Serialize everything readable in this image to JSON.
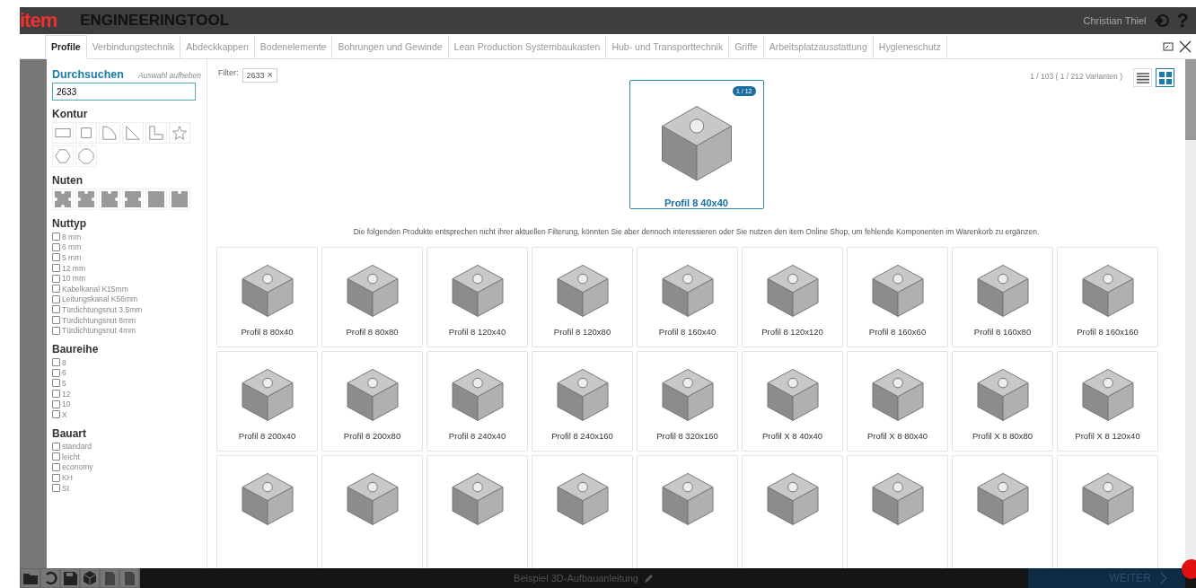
{
  "header": {
    "logo": "item",
    "title": "ENGINEERINGTOOL",
    "user": "Christian Thiel",
    "help": "?"
  },
  "tabs": [
    {
      "label": "Profile",
      "selected": true
    },
    {
      "label": "Verbindungstechnik",
      "selected": false
    },
    {
      "label": "Abdeckkappen",
      "selected": false
    },
    {
      "label": "Bodenelemente",
      "selected": false
    },
    {
      "label": "Bohrungen und Gewinde",
      "selected": false
    },
    {
      "label": "Lean Production Systembaukasten",
      "selected": false
    },
    {
      "label": "Hub- und Transporttechnik",
      "selected": false
    },
    {
      "label": "Griffe",
      "selected": false
    },
    {
      "label": "Arbeitsplatzausstattung",
      "selected": false
    },
    {
      "label": "Hygieneschutz",
      "selected": false
    }
  ],
  "sidebar": {
    "search_title": "Durchsuchen",
    "clear_link": "Auswahl aufheben",
    "search_value": "2633",
    "kontur_title": "Kontur",
    "nuten_title": "Nuten",
    "groups": [
      {
        "title": "Nuttyp",
        "options": [
          {
            "label": "8 mm",
            "checked": false
          },
          {
            "label": "6 mm",
            "checked": false
          },
          {
            "label": "5 mm",
            "checked": false
          },
          {
            "label": "12 mm",
            "checked": false
          },
          {
            "label": "10 mm",
            "checked": false
          },
          {
            "label": "Kabelkanal K15mm",
            "checked": false
          },
          {
            "label": "Leitungskanal K56mm",
            "checked": false
          },
          {
            "label": "Türdichtungsnut 3.5mm",
            "checked": false
          },
          {
            "label": "Türdichtungsnut 8mm",
            "checked": false
          },
          {
            "label": "Türdichtungsnut 4mm",
            "checked": false
          }
        ]
      },
      {
        "title": "Baureihe",
        "options": [
          {
            "label": "8",
            "checked": false
          },
          {
            "label": "6",
            "checked": false
          },
          {
            "label": "5",
            "checked": false
          },
          {
            "label": "12",
            "checked": false
          },
          {
            "label": "10",
            "checked": false
          },
          {
            "label": "X",
            "checked": false
          }
        ]
      },
      {
        "title": "Bauart",
        "options": [
          {
            "label": "standard",
            "checked": false
          },
          {
            "label": "leicht",
            "checked": false
          },
          {
            "label": "economy",
            "checked": false
          },
          {
            "label": "KH",
            "checked": false
          },
          {
            "label": "St",
            "checked": false
          }
        ]
      }
    ]
  },
  "main": {
    "filter_label": "Filter:",
    "filter_chip": "2633",
    "filter_remove": "×",
    "count": "1 / 103 ( 1 / 212 Varianten )",
    "views": [
      {
        "kind": "list",
        "selected": false
      },
      {
        "kind": "grid",
        "selected": true
      }
    ],
    "featured": {
      "name": "Profil 8 40x40",
      "badge": "1 / 12"
    },
    "notice": "Die folgenden Produkte entsprechen nicht ihrer aktuellen Filterung, könnten Sie aber dennoch interessieren oder Sie nutzen den item Online Shop, um fehlende Komponenten im Warenkorb zu ergänzen.",
    "products": [
      {
        "name": "Profil 8 80x40"
      },
      {
        "name": "Profil 8 80x80"
      },
      {
        "name": "Profil 8 120x40"
      },
      {
        "name": "Profil 8 120x80"
      },
      {
        "name": "Profil 8 160x40"
      },
      {
        "name": "Profil 8 120x120"
      },
      {
        "name": "Profil 8 160x60"
      },
      {
        "name": "Profil 8 160x80"
      },
      {
        "name": "Profil 8 160x160"
      },
      {
        "name": "Profil 8 200x40"
      },
      {
        "name": "Profil 8 200x80"
      },
      {
        "name": "Profil 8 240x40"
      },
      {
        "name": "Profil 8 240x160"
      },
      {
        "name": "Profil 8 320x160"
      },
      {
        "name": "Profil X 8 40x40"
      },
      {
        "name": "Profil X 8 80x40"
      },
      {
        "name": "Profil X 8 80x80"
      },
      {
        "name": "Profil X 8 120x40"
      },
      {
        "cut_off": true
      },
      {
        "cut_off": true
      },
      {
        "cut_off": true
      },
      {
        "cut_off": true
      },
      {
        "cut_off": true
      },
      {
        "cut_off": true
      },
      {
        "cut_off": true
      },
      {
        "cut_off": true
      },
      {
        "cut_off": true
      }
    ]
  },
  "bottom_bar": {
    "project": "Beispiel 3D-Aufbauanleitung",
    "next": "WEITER"
  }
}
